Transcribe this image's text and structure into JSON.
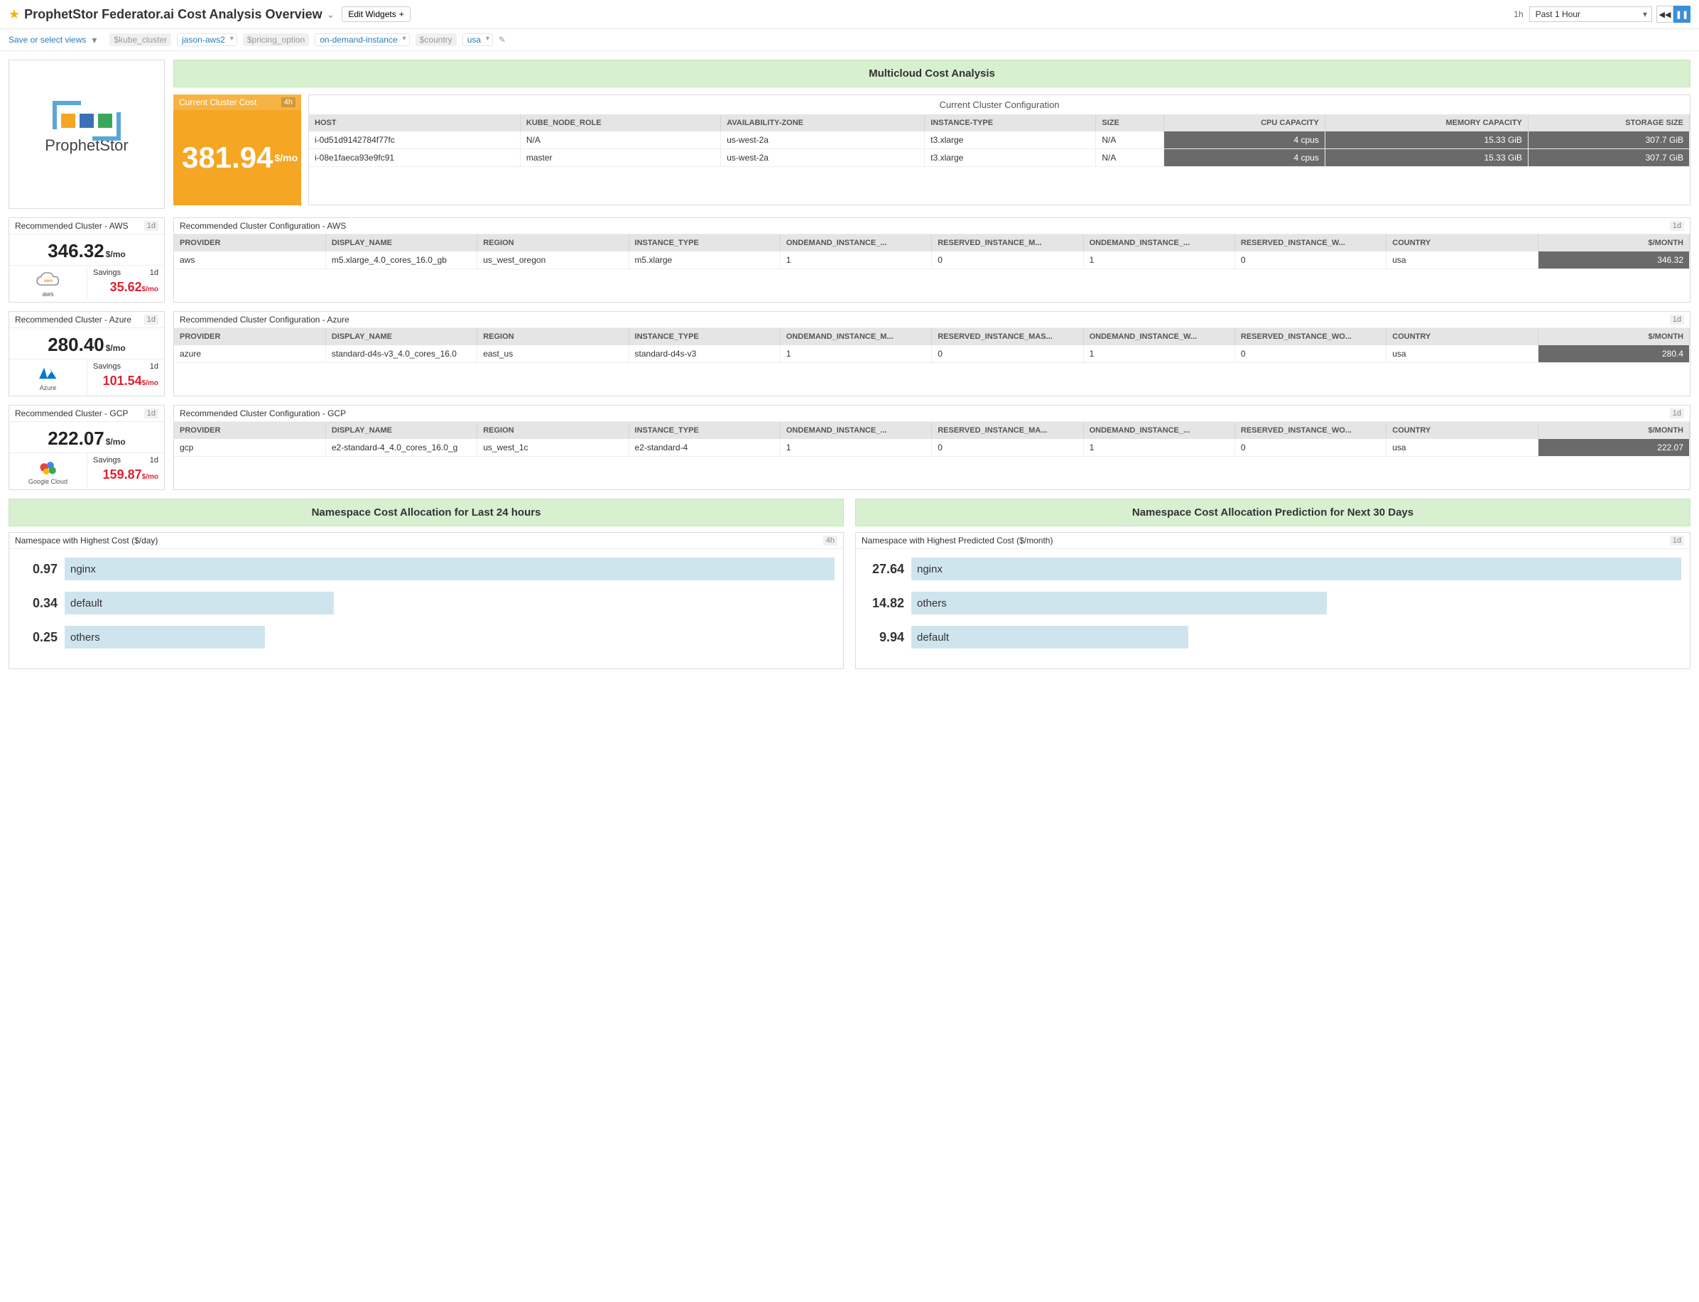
{
  "header": {
    "title": "ProphetStor Federator.ai Cost Analysis Overview",
    "edit_widgets": "Edit Widgets",
    "time_short": "1h",
    "time_label": "Past 1 Hour"
  },
  "varbar": {
    "save_views": "Save or select views",
    "kube_cluster_label": "$kube_cluster",
    "kube_cluster_value": "jason-aws2",
    "pricing_label": "$pricing_option",
    "pricing_value": "on-demand-instance",
    "country_label": "$country",
    "country_value": "usa"
  },
  "logo": {
    "text": "ProphetStor"
  },
  "multicloud": {
    "heading": "Multicloud Cost Analysis",
    "current_cost_title": "Current Cluster Cost",
    "current_cost_tf": "4h",
    "current_cost_value": "381.94",
    "current_cost_unit": "$/mo",
    "config_title": "Current Cluster Configuration",
    "config_cols": [
      "HOST",
      "KUBE_NODE_ROLE",
      "AVAILABILITY-ZONE",
      "INSTANCE-TYPE",
      "SIZE",
      "CPU CAPACITY",
      "MEMORY CAPACITY",
      "STORAGE SIZE"
    ],
    "config_rows": [
      [
        "i-0d51d9142784f77fc",
        "N/A",
        "us-west-2a",
        "t3.xlarge",
        "N/A",
        "4 cpus",
        "15.33 GiB",
        "307.7 GiB"
      ],
      [
        "i-08e1faeca93e9fc91",
        "master",
        "us-west-2a",
        "t3.xlarge",
        "N/A",
        "4 cpus",
        "15.33 GiB",
        "307.7 GiB"
      ]
    ]
  },
  "rec": {
    "aws": {
      "left_title": "Recommended Cluster - AWS",
      "tf": "1d",
      "value": "346.32",
      "unit": "$/mo",
      "savings_label": "Savings",
      "savings_tf": "1d",
      "savings_value": "35.62",
      "savings_unit": "$/mo",
      "icon_label": "aws",
      "right_title": "Recommended Cluster Configuration - AWS",
      "right_tf": "1d",
      "cols": [
        "PROVIDER",
        "DISPLAY_NAME",
        "REGION",
        "INSTANCE_TYPE",
        "ONDEMAND_INSTANCE_...",
        "RESERVED_INSTANCE_M...",
        "ONDEMAND_INSTANCE_...",
        "RESERVED_INSTANCE_W...",
        "COUNTRY",
        "$/MONTH"
      ],
      "row": [
        "aws",
        "m5.xlarge_4.0_cores_16.0_gb",
        "us_west_oregon",
        "m5.xlarge",
        "1",
        "0",
        "1",
        "0",
        "usa",
        "346.32"
      ]
    },
    "azure": {
      "left_title": "Recommended Cluster - Azure",
      "tf": "1d",
      "value": "280.40",
      "unit": "$/mo",
      "savings_label": "Savings",
      "savings_tf": "1d",
      "savings_value": "101.54",
      "savings_unit": "$/mo",
      "icon_label": "Azure",
      "right_title": "Recommended Cluster Configuration - Azure",
      "right_tf": "1d",
      "cols": [
        "PROVIDER",
        "DISPLAY_NAME",
        "REGION",
        "INSTANCE_TYPE",
        "ONDEMAND_INSTANCE_M...",
        "RESERVED_INSTANCE_MAS...",
        "ONDEMAND_INSTANCE_W...",
        "RESERVED_INSTANCE_WO...",
        "COUNTRY",
        "$/MONTH"
      ],
      "row": [
        "azure",
        "standard-d4s-v3_4.0_cores_16.0",
        "east_us",
        "standard-d4s-v3",
        "1",
        "0",
        "1",
        "0",
        "usa",
        "280.4"
      ]
    },
    "gcp": {
      "left_title": "Recommended Cluster - GCP",
      "tf": "1d",
      "value": "222.07",
      "unit": "$/mo",
      "savings_label": "Savings",
      "savings_tf": "1d",
      "savings_value": "159.87",
      "savings_unit": "$/mo",
      "icon_label": "Google Cloud",
      "right_title": "Recommended Cluster Configuration - GCP",
      "right_tf": "1d",
      "cols": [
        "PROVIDER",
        "DISPLAY_NAME",
        "REGION",
        "INSTANCE_TYPE",
        "ONDEMAND_INSTANCE_...",
        "RESERVED_INSTANCE_MA...",
        "ONDEMAND_INSTANCE_...",
        "RESERVED_INSTANCE_WO...",
        "COUNTRY",
        "$/MONTH"
      ],
      "row": [
        "gcp",
        "e2-standard-4_4.0_cores_16.0_g",
        "us_west_1c",
        "e2-standard-4",
        "1",
        "0",
        "1",
        "0",
        "usa",
        "222.07"
      ]
    }
  },
  "ns": {
    "left_heading": "Namespace Cost Allocation for Last 24 hours",
    "left_title": "Namespace with Highest Cost ($/day)",
    "left_tf": "4h",
    "left_rows": [
      {
        "val": "0.97",
        "label": "nginx",
        "pct": 100
      },
      {
        "val": "0.34",
        "label": "default",
        "pct": 35
      },
      {
        "val": "0.25",
        "label": "others",
        "pct": 26
      }
    ],
    "right_heading": "Namespace Cost Allocation Prediction for Next 30 Days",
    "right_title": "Namespace with Highest Predicted Cost ($/month)",
    "right_tf": "1d",
    "right_rows": [
      {
        "val": "27.64",
        "label": "nginx",
        "pct": 100
      },
      {
        "val": "14.82",
        "label": "others",
        "pct": 54
      },
      {
        "val": "9.94",
        "label": "default",
        "pct": 36
      }
    ]
  },
  "chart_data": [
    {
      "type": "bar",
      "title": "Namespace with Highest Cost ($/day)",
      "categories": [
        "nginx",
        "default",
        "others"
      ],
      "values": [
        0.97,
        0.34,
        0.25
      ],
      "xlabel": "$/day",
      "ylabel": ""
    },
    {
      "type": "bar",
      "title": "Namespace with Highest Predicted Cost ($/month)",
      "categories": [
        "nginx",
        "others",
        "default"
      ],
      "values": [
        27.64,
        14.82,
        9.94
      ],
      "xlabel": "$/month",
      "ylabel": ""
    }
  ]
}
